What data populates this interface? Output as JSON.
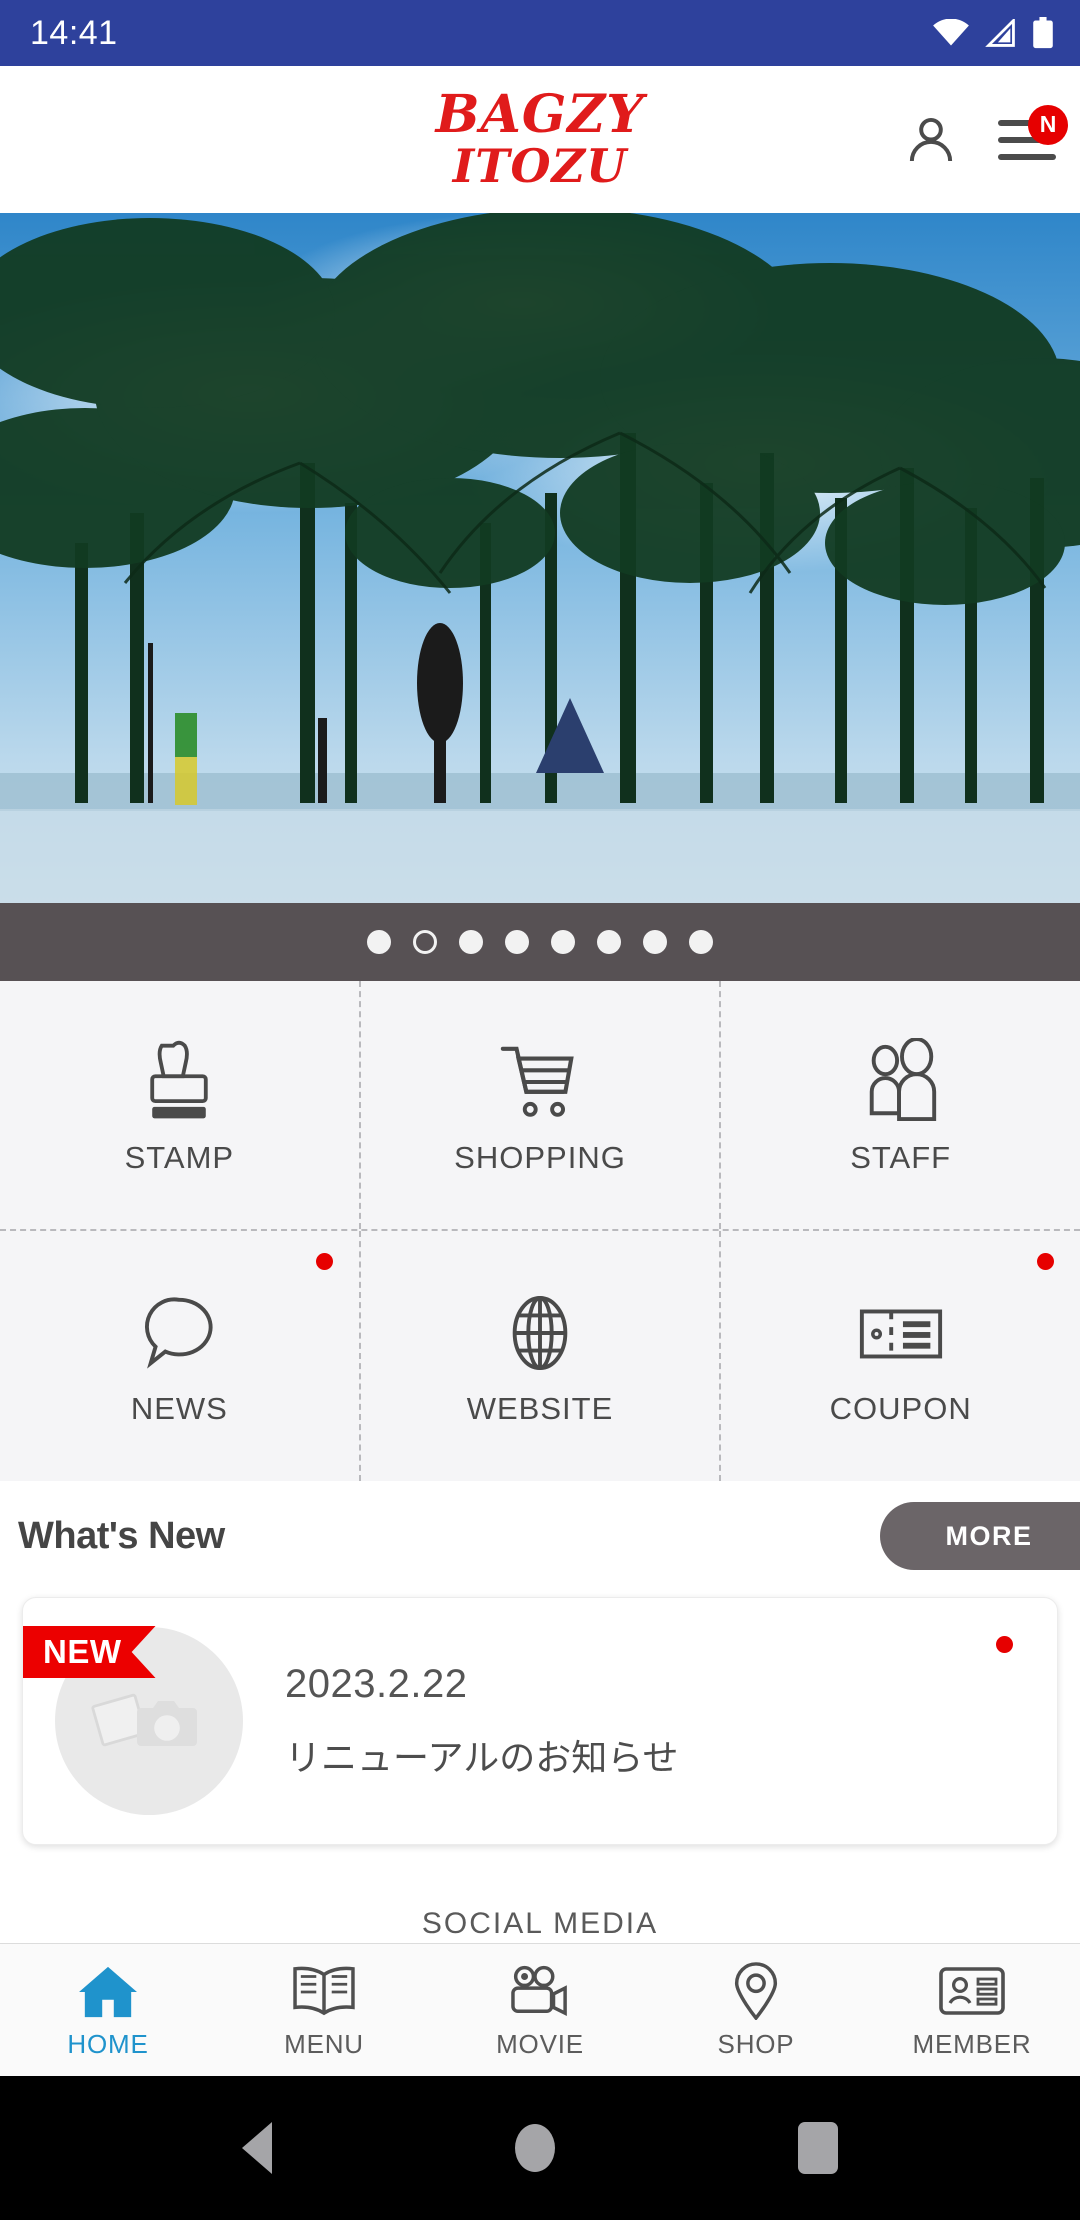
{
  "status_bar": {
    "time": "14:41",
    "icons": [
      "wifi-icon",
      "cellular-signal-icon",
      "battery-icon"
    ]
  },
  "header": {
    "logo_line1": "BAGZY",
    "logo_line2": "ITOZU",
    "account_icon": "person-icon",
    "menu_icon": "hamburger-menu-icon",
    "menu_badge": "N",
    "badge_color": "#e60000",
    "logo_color": "#e01b1b"
  },
  "hero": {
    "alt": "palm-trees-beach-photo",
    "carousel": {
      "total_dots": 8,
      "active_index": 1
    }
  },
  "grid_menu": {
    "rows": [
      [
        {
          "label": "STAMP",
          "icon": "stamp-icon",
          "dot": false
        },
        {
          "label": "SHOPPING",
          "icon": "shopping-cart-icon",
          "dot": false
        },
        {
          "label": "STAFF",
          "icon": "staff-people-icon",
          "dot": false
        }
      ],
      [
        {
          "label": "NEWS",
          "icon": "speech-bubble-icon",
          "dot": true
        },
        {
          "label": "WEBSITE",
          "icon": "globe-icon",
          "dot": false
        },
        {
          "label": "COUPON",
          "icon": "coupon-ticket-icon",
          "dot": true
        }
      ]
    ]
  },
  "whats_new": {
    "title": "What's New",
    "more_label": "MORE",
    "items": [
      {
        "badge": "NEW",
        "date": "2023.2.22",
        "title": "リニューアルのお知らせ",
        "thumb_icon": "photo-placeholder-icon",
        "unread": true
      }
    ]
  },
  "social_media": {
    "title": "SOCIAL MEDIA"
  },
  "bottom_nav": {
    "active_color": "#1f93cc",
    "items": [
      {
        "label": "HOME",
        "icon": "home-icon",
        "active": true
      },
      {
        "label": "MENU",
        "icon": "open-book-icon",
        "active": false
      },
      {
        "label": "MOVIE",
        "icon": "video-camera-icon",
        "active": false
      },
      {
        "label": "SHOP",
        "icon": "map-pin-icon",
        "active": false
      },
      {
        "label": "MEMBER",
        "icon": "id-card-icon",
        "active": false
      }
    ]
  },
  "android_nav": {
    "back": "back-triangle-icon",
    "home": "home-circle-icon",
    "recents": "recents-square-icon"
  }
}
